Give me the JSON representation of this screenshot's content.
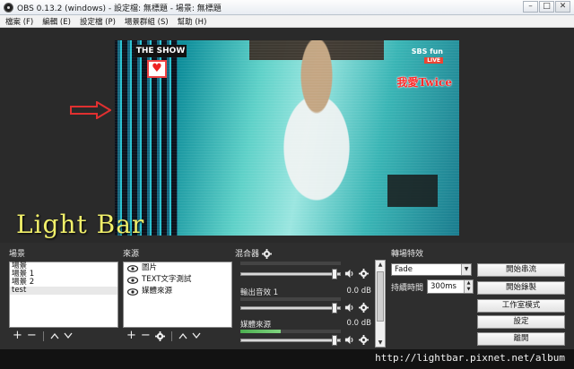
{
  "window": {
    "title": "OBS 0.13.2 (windows) - 設定檔: 無標題 - 場景: 無標題",
    "minimize": "–",
    "maximize": "□",
    "close": "✕"
  },
  "menu": [
    "檔案 (F)",
    "編輯 (E)",
    "設定檔 (P)",
    "場景群組 (S)",
    "幫助 (H)"
  ],
  "preview": {
    "show_logo": "THE SHOW",
    "channel": "SBS fun",
    "live_badge": "LIVE",
    "overlay_red_text": "我愛Twice",
    "overlay_yellow_text": "Light Bar"
  },
  "scenes": {
    "label": "場景",
    "items": [
      "場景",
      "場景 1",
      "場景 2",
      "test"
    ],
    "selected_index": 3,
    "add": "+",
    "remove": "−"
  },
  "sources": {
    "label": "來源",
    "items": [
      "圖片",
      "TEXT文字測試",
      "媒體來源"
    ],
    "add": "+",
    "remove": "−"
  },
  "mixer": {
    "label": "混合器",
    "channels": [
      {
        "name": "",
        "db": "",
        "level": 0.0,
        "volume": 0.95
      },
      {
        "name": "輸出音效 1",
        "db": "0.0 dB",
        "level": 0.0,
        "volume": 0.95
      },
      {
        "name": "媒體來源",
        "db": "0.0 dB",
        "level": 0.4,
        "volume": 0.95
      }
    ]
  },
  "transitions": {
    "label": "轉場特效",
    "selected": "Fade",
    "duration_label": "持續時間",
    "duration_value": "300ms"
  },
  "controls": {
    "start_streaming": "開始串流",
    "start_recording": "開始錄製",
    "studio_mode": "工作室模式",
    "settings": "設定",
    "exit": "離開"
  },
  "watermark": "http://lightbar.pixnet.net/album",
  "colors": {
    "ui_background": "#2e2e2e",
    "overlay_yellow": "#f0ef6a",
    "overlay_red": "#ff2a2a",
    "arrow_red": "#e03030"
  }
}
